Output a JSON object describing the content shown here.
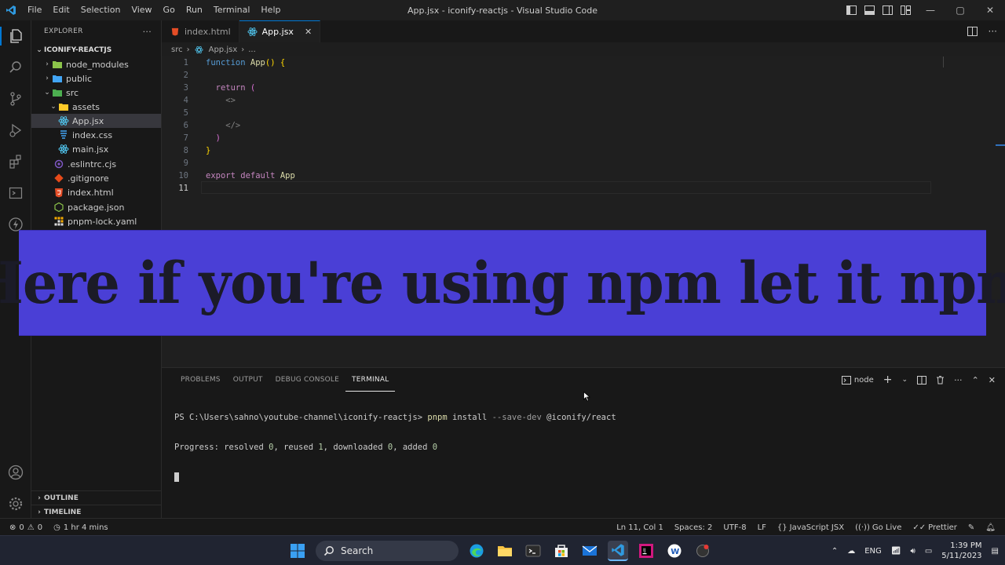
{
  "titlebar": {
    "menu": [
      "File",
      "Edit",
      "Selection",
      "View",
      "Go",
      "Run",
      "Terminal",
      "Help"
    ],
    "title": "App.jsx - iconify-reactjs - Visual Studio Code",
    "win_min": "—",
    "win_max": "▢",
    "win_close": "✕"
  },
  "sidebar": {
    "header": "EXPLORER",
    "more": "···",
    "folder": "ICONIFY-REACTJS",
    "items": [
      {
        "label": "node_modules",
        "chevron": "›"
      },
      {
        "label": "public",
        "chevron": "›"
      },
      {
        "label": "src",
        "chevron": "⌄"
      },
      {
        "label": "assets",
        "chevron": "⌄"
      },
      {
        "label": "App.jsx"
      },
      {
        "label": "index.css"
      },
      {
        "label": "main.jsx"
      },
      {
        "label": ".eslintrc.cjs"
      },
      {
        "label": ".gitignore"
      },
      {
        "label": "index.html"
      },
      {
        "label": "package.json"
      },
      {
        "label": "pnpm-lock.yaml"
      }
    ],
    "outline": "OUTLINE",
    "timeline": "TIMELINE"
  },
  "tabs": [
    {
      "label": "index.html"
    },
    {
      "label": "App.jsx",
      "close": "✕"
    }
  ],
  "breadcrumb": {
    "parts": [
      "src",
      "App.jsx",
      "..."
    ],
    "sep": "›"
  },
  "editor": {
    "line_numbers": [
      "1",
      "2",
      "3",
      "4",
      "5",
      "6",
      "7",
      "8",
      "9",
      "10",
      "11"
    ],
    "lines": [
      {
        "tokens": [
          {
            "t": "function ",
            "c": "#569cd6"
          },
          {
            "t": "App",
            "c": "#dcdcaa"
          },
          {
            "t": "() {",
            "c": "#ffd700"
          }
        ]
      },
      {
        "tokens": []
      },
      {
        "tokens": [
          {
            "t": "  return ",
            "c": "#c586c0"
          },
          {
            "t": "(",
            "c": "#da70d6"
          }
        ]
      },
      {
        "tokens": [
          {
            "t": "    <>",
            "c": "#808080"
          }
        ]
      },
      {
        "tokens": []
      },
      {
        "tokens": [
          {
            "t": "    </>",
            "c": "#808080"
          }
        ]
      },
      {
        "tokens": [
          {
            "t": "  )",
            "c": "#da70d6"
          }
        ]
      },
      {
        "tokens": [
          {
            "t": "}",
            "c": "#ffd700"
          }
        ]
      },
      {
        "tokens": []
      },
      {
        "tokens": [
          {
            "t": "export default ",
            "c": "#c586c0"
          },
          {
            "t": "App",
            "c": "#dcdcaa"
          }
        ]
      },
      {
        "tokens": []
      }
    ]
  },
  "banner": {
    "text": "Here if you're using npm let it npm"
  },
  "panel": {
    "tabs": [
      "PROBLEMS",
      "OUTPUT",
      "DEBUG CONSOLE",
      "TERMINAL"
    ],
    "active_tab": "TERMINAL",
    "shell": "node",
    "add": "+",
    "caret": "⌄",
    "more": "···",
    "up": "⌃",
    "close": "✕",
    "terminal": {
      "prompt": "PS C:\\Users\\sahno\\youtube-channel\\iconify-reactjs> ",
      "cmd": "pnpm",
      "args": " install ",
      "flag": "--save-dev",
      "pkg": " @iconify/react",
      "progress_label": "Progress: resolved ",
      "resolved": "0",
      "reused_label": ", reused ",
      "reused": "1",
      "downloaded_label": ", downloaded ",
      "downloaded": "0",
      "added_label": ", added ",
      "added": "0"
    }
  },
  "statusbar": {
    "errors": "0",
    "warnings": "0",
    "time": "1 hr 4 mins",
    "position": "Ln 11, Col 1",
    "spaces": "Spaces: 2",
    "encoding": "UTF-8",
    "eol": "LF",
    "language": "JavaScript JSX",
    "golive": "Go Live",
    "prettier": "Prettier"
  },
  "taskbar": {
    "search": "Search",
    "lang": "ENG",
    "time": "1:39 PM",
    "date": "5/11/2023"
  },
  "colors": {
    "accent": "#0078d4",
    "banner": "#4a3fd6",
    "react": "#4fc1e9",
    "html": "#e44d26",
    "css": "#42a5f5"
  }
}
